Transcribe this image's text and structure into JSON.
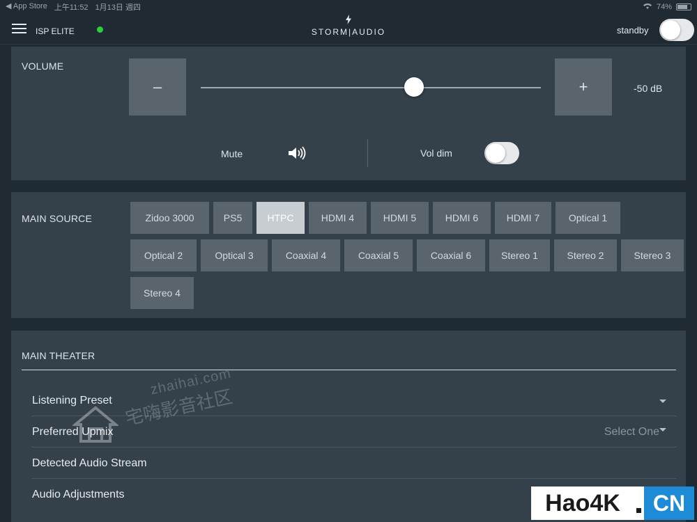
{
  "status_bar": {
    "back_app": "◀ App Store",
    "time": "上午11:52",
    "date": "1月13日 週四",
    "battery": "74%"
  },
  "header": {
    "device_name": "ISP ELITE",
    "logo_text": "STORM|AUDIO",
    "standby_label": "standby",
    "standby_on": false,
    "status_color": "#2ecc40"
  },
  "volume": {
    "title": "VOLUME",
    "minus_label": "–",
    "plus_label": "+",
    "value_label": "-50 dB",
    "slider_fraction": 0.627,
    "mute_label": "Mute",
    "voldim_label": "Vol dim",
    "voldim_on": false
  },
  "main_source": {
    "title": "MAIN SOURCE",
    "active": "HTPC",
    "sources": [
      "Zidoo 3000",
      "PS5",
      "HTPC",
      "HDMI 4",
      "HDMI 5",
      "HDMI 6",
      "HDMI 7",
      "Optical 1",
      "Optical 2",
      "Optical 3",
      "Coaxial 4",
      "Coaxial 5",
      "Coaxial 6",
      "Stereo 1",
      "Stereo 2",
      "Stereo 3",
      "Stereo 4"
    ]
  },
  "main_theater": {
    "title": "MAIN THEATER",
    "rows": [
      {
        "label": "Listening Preset",
        "value": ""
      },
      {
        "label": "Preferred Upmix",
        "value": "Select One"
      },
      {
        "label": "Detected Audio Stream",
        "value": ""
      },
      {
        "label": "Audio Adjustments",
        "value": ""
      }
    ]
  },
  "watermarks": {
    "site": "zhaihai.com",
    "cn": "宅嗨影音社区",
    "badge_left": "Hao4K",
    "badge_right": "CN"
  },
  "colors": {
    "background": "#1f2a33",
    "panel": "#34404a",
    "button": "#5a646d",
    "active_button": "#c8cdd1"
  }
}
